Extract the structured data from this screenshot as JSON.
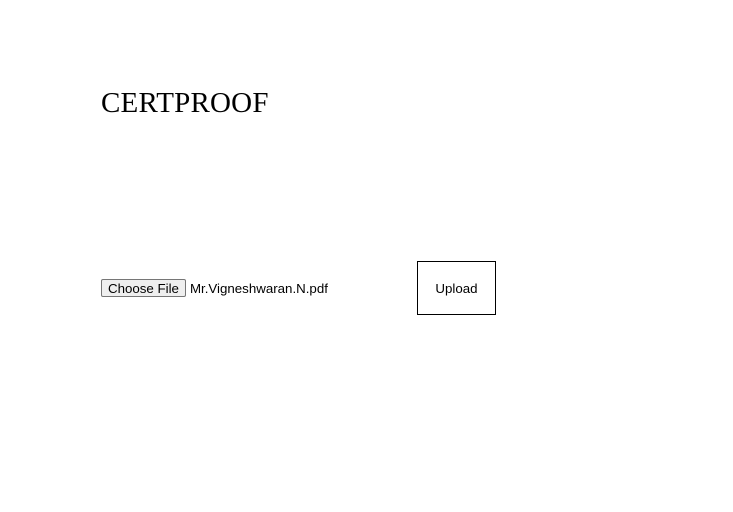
{
  "header": {
    "title": "CERTPROOF"
  },
  "upload_form": {
    "choose_file_label": "Choose File",
    "selected_file_name": "Mr.Vigneshwaran.N.pdf",
    "upload_label": "Upload"
  }
}
